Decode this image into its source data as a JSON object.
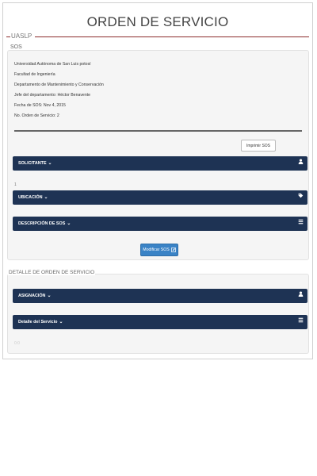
{
  "title": "ORDEN DE SERVICIO",
  "uaslp_legend": "UASLP",
  "sos_legend": "SOS",
  "info": {
    "universidad": "Universidad Autónoma de San Luis potosí",
    "facultad": "Facultad de Ingeniería",
    "departamento": "Departamento de Mantenimiento y Conservación",
    "jefe": "Jefe del departamento: Héctor Benavente",
    "fecha": "Fecha de SOS: Nov 4, 2015",
    "no_orden": "No. Orden de Servicio: 2"
  },
  "buttons": {
    "imprimir": "Imprimir SOS",
    "modificar": "Modificar SOS"
  },
  "sections": {
    "solicitante": "SOLICITANTE",
    "ubicacion": "UBICACIÓN",
    "descripcion": "DESCRIPCIÓN DE SOS",
    "asignacion": "ASIGNACIÓN",
    "detalle_servicio": "Detalle del Servicio"
  },
  "small_number": "1",
  "detalle_legend": "DETALLE DE ORDEN DE SERVICIO",
  "faint_text": "0:0",
  "icons": {
    "chevron": "chevron-down-icon",
    "solicitante": "user-icon",
    "ubicacion": "tag-icon",
    "descripcion": "list-icon",
    "asignacion": "user-icon",
    "detalle": "list-icon",
    "modificar": "edit-icon"
  },
  "colors": {
    "bar_bg": "#1e3354",
    "accent_line": "#8b2a2a",
    "button_primary": "#3a83c6"
  }
}
